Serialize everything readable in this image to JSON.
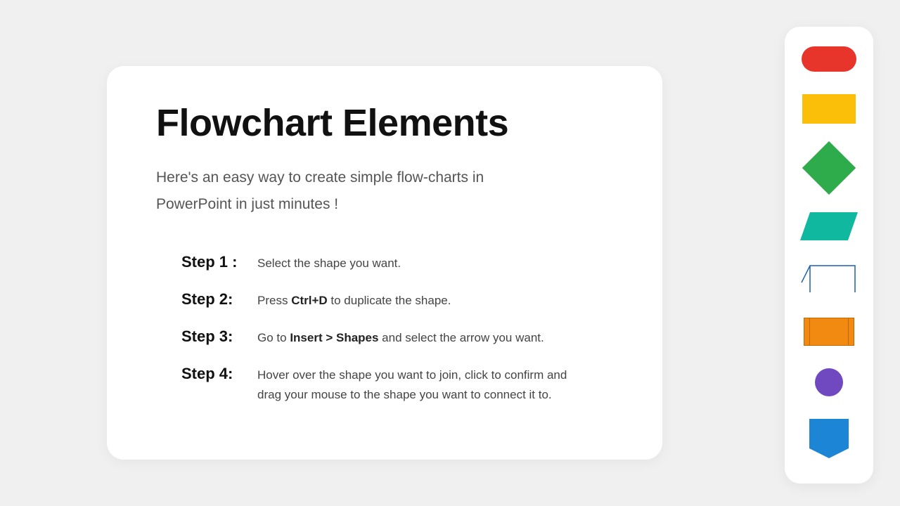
{
  "title": "Flowchart Elements",
  "subtitle": "Here's an easy way to create simple flow-charts in PowerPoint in just minutes !",
  "steps": [
    {
      "label": "Step 1 :",
      "text": "Select the shape you want."
    },
    {
      "label": "Step 2:",
      "text": "Press <b>Ctrl+D</b> to duplicate the shape."
    },
    {
      "label": "Step 3:",
      "text": "Go to <b>Insert > Shapes</b> and select the arrow you want."
    },
    {
      "label": "Step 4:",
      "text": "Hover over the shape you want to join, click to confirm and drag your mouse to the shape you want to connect it to."
    }
  ],
  "palette": {
    "shapes": [
      "terminator",
      "process",
      "decision",
      "data",
      "manual-input",
      "subroutine",
      "connector",
      "off-page"
    ],
    "colors": {
      "terminator": "#e7352c",
      "process": "#fbbf0a",
      "decision": "#2eab4b",
      "data": "#10b8a0",
      "manual": "#1c5fb0",
      "subroutine": "#f28a12",
      "connector": "#7049c0",
      "offpage": "#1c85d6"
    }
  }
}
